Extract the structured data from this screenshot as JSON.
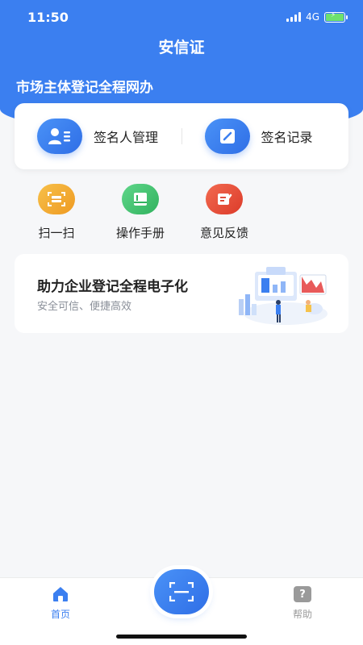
{
  "status_bar": {
    "time": "11:50",
    "network": "4G"
  },
  "header": {
    "app_title": "安信证",
    "subtitle": "市场主体登记全程网办"
  },
  "main_actions": [
    {
      "label": "签名人管理",
      "icon": "user-card-icon"
    },
    {
      "label": "签名记录",
      "icon": "edit-note-icon"
    }
  ],
  "quick_actions": [
    {
      "label": "扫一扫",
      "icon": "scan-icon",
      "color": "#f0a92f"
    },
    {
      "label": "操作手册",
      "icon": "book-icon",
      "color": "#3fbf6e"
    },
    {
      "label": "意见反馈",
      "icon": "feedback-icon",
      "color": "#e8503a"
    }
  ],
  "banner": {
    "title": "助力企业登记全程电子化",
    "subtitle": "安全可信、便捷高效"
  },
  "tabbar": {
    "home_label": "首页",
    "help_label": "帮助",
    "help_icon_text": "?",
    "active_color": "#3b7ff0",
    "inactive_color": "#9a9a9a"
  },
  "colors": {
    "primary": "#3b7ff0",
    "background": "#f6f7f9"
  }
}
